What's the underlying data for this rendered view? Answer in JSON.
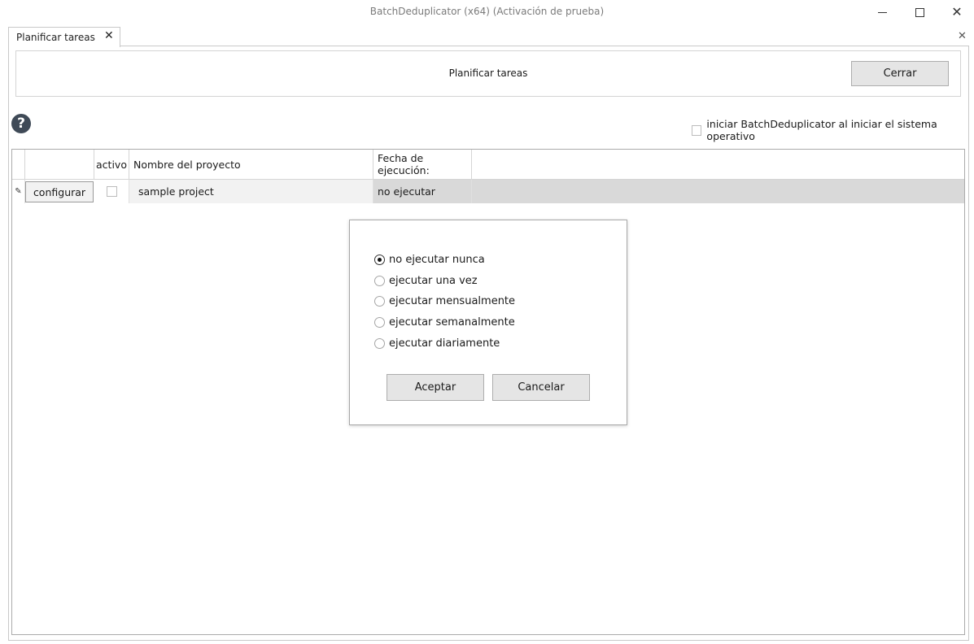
{
  "window": {
    "title": "BatchDeduplicator  (x64) (Activación de prueba)",
    "close_glyph": "✕"
  },
  "tab": {
    "label": "Planificar tareas",
    "close_glyph": "✕"
  },
  "panel": {
    "close_glyph": "✕",
    "title": "Planificar tareas",
    "close_button_label": "Cerrar",
    "help_glyph": "?",
    "autostart_label": "iniciar BatchDeduplicator al iniciar el sistema operativo",
    "autostart_checked": false
  },
  "grid": {
    "columns": {
      "active": "activo",
      "project_name": "Nombre del proyecto",
      "run_date": "Fecha de ejecución:"
    },
    "rows": [
      {
        "configure_label": "configurar",
        "active": false,
        "project_name": "sample project",
        "run_date": "no ejecutar"
      }
    ]
  },
  "dialog": {
    "options": [
      "no ejecutar nunca",
      "ejecutar una vez",
      "ejecutar mensualmente",
      "ejecutar semanalmente",
      "ejecutar diariamente"
    ],
    "selected_option": "no ejecutar nunca",
    "accept_label": "Aceptar",
    "cancel_label": "Cancelar"
  },
  "colors": {
    "button_face": "#e5e5e5",
    "selected_row": "#d9d9d9",
    "help_icon": "#3f4a57"
  },
  "icons": {
    "help": "question-circle-icon",
    "row_edit": "pencil-icon"
  }
}
